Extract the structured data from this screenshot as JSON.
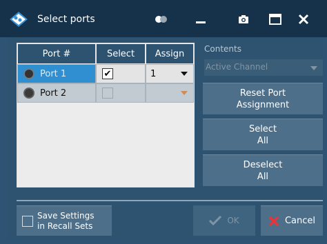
{
  "window": {
    "title": "Select ports"
  },
  "table": {
    "headers": [
      "Port #",
      "Select",
      "Assign"
    ],
    "rows": [
      {
        "port": "Port 1",
        "selected": "✔",
        "assign": "1"
      },
      {
        "port": "Port 2",
        "selected": "",
        "assign": ""
      }
    ]
  },
  "contents": {
    "label": "Contents",
    "value": "Active Channel"
  },
  "buttons": {
    "reset_line1": "Reset Port",
    "reset_line2": "Assignment",
    "select_line1": "Select",
    "select_line2": "All",
    "deselect_line1": "Deselect",
    "deselect_line2": "All",
    "save_line1": "Save Settings",
    "save_line2": "in Recall Sets",
    "ok": "OK",
    "cancel": "Cancel"
  },
  "colors": {
    "titlebar": "#16324b",
    "background": "#2f5473",
    "selected_row": "#2f8fd0",
    "cancel_icon": "#e8353a"
  },
  "icons": [
    "app-logo-icon",
    "toggle-icon",
    "minimize-icon",
    "camera-icon",
    "maximize-icon",
    "close-icon",
    "checkmark-icon",
    "cancel-x-icon"
  ]
}
